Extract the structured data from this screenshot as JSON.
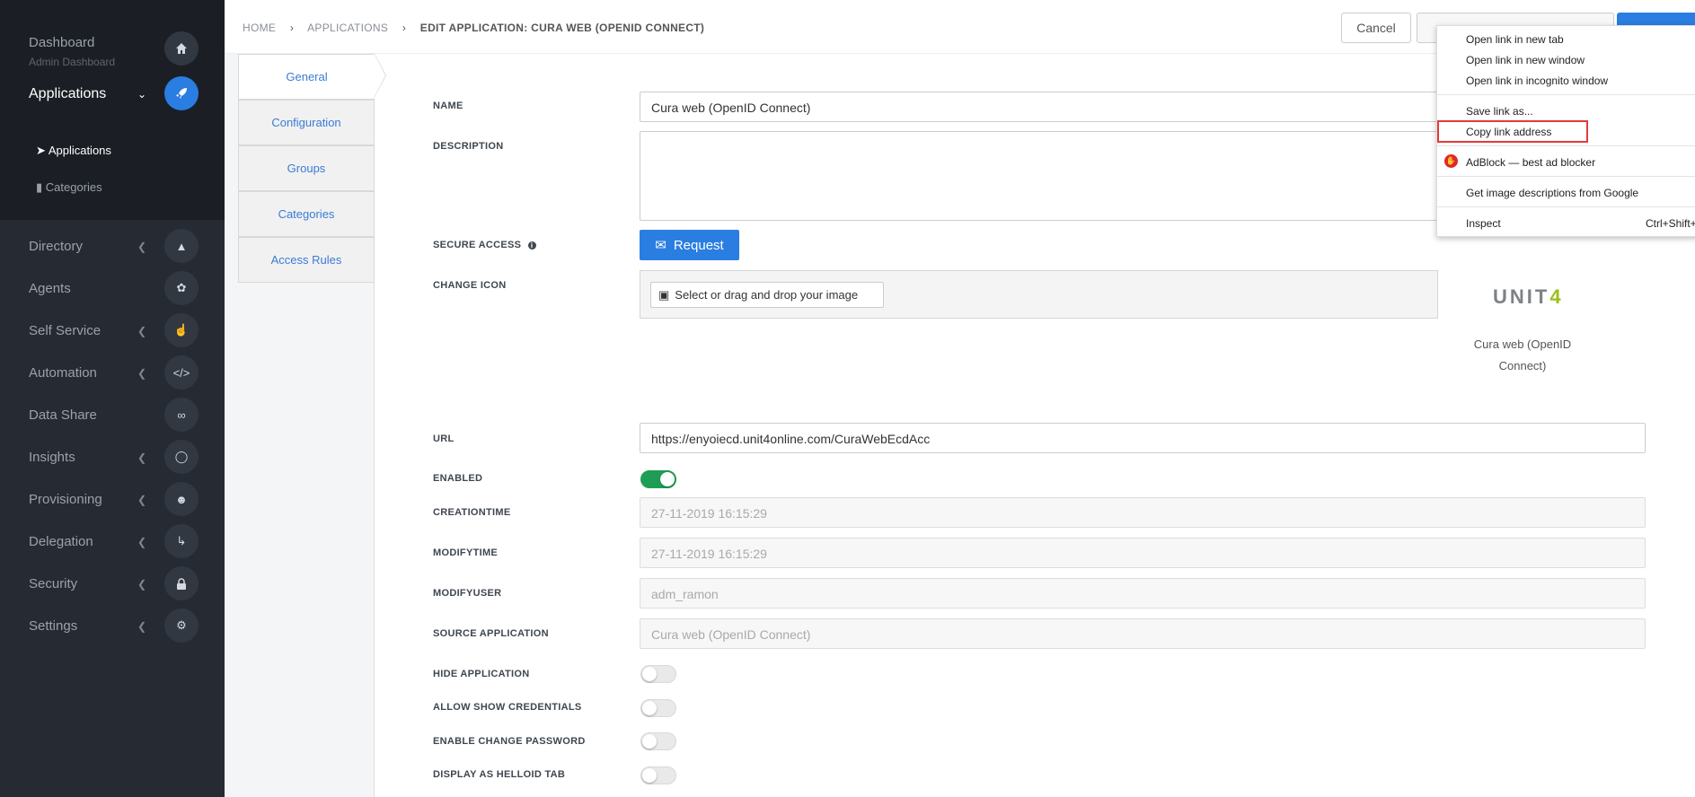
{
  "sidebar": {
    "dashboard": {
      "label": "Dashboard",
      "sub": "Admin Dashboard"
    },
    "applications": {
      "label": "Applications"
    },
    "subitems": [
      {
        "label": "Applications"
      },
      {
        "label": "Categories"
      }
    ],
    "items": [
      {
        "label": "Directory"
      },
      {
        "label": "Agents"
      },
      {
        "label": "Self Service"
      },
      {
        "label": "Automation"
      },
      {
        "label": "Data Share"
      },
      {
        "label": "Insights"
      },
      {
        "label": "Provisioning"
      },
      {
        "label": "Delegation"
      },
      {
        "label": "Security"
      },
      {
        "label": "Settings"
      }
    ]
  },
  "breadcrumb": {
    "home": "HOME",
    "applications": "APPLICATIONS",
    "current": "EDIT APPLICATION: CURA WEB (OPENID CONNECT)"
  },
  "toolbar": {
    "cancel": "Cancel"
  },
  "tabs": [
    {
      "label": "General"
    },
    {
      "label": "Configuration"
    },
    {
      "label": "Groups"
    },
    {
      "label": "Categories"
    },
    {
      "label": "Access Rules"
    }
  ],
  "form": {
    "name_label": "NAME",
    "name_value": "Cura web (OpenID Connect)",
    "description_label": "DESCRIPTION",
    "secure_access_label": "SECURE ACCESS",
    "request_button": "Request",
    "change_icon_label": "CHANGE ICON",
    "select_image": "Select or drag and drop your image",
    "url_label": "URL",
    "url_value": "https://enyoiecd.unit4online.com/CuraWebEcdAcc",
    "enabled_label": "ENABLED",
    "creationtime_label": "CREATIONTIME",
    "creationtime_value": "27-11-2019 16:15:29",
    "modifytime_label": "MODIFYTIME",
    "modifytime_value": "27-11-2019 16:15:29",
    "modifyuser_label": "MODIFYUSER",
    "modifyuser_value": "adm_ramon",
    "source_label": "SOURCE APPLICATION",
    "source_value": "Cura web (OpenID Connect)",
    "hide_label": "HIDE APPLICATION",
    "allow_show_label": "ALLOW SHOW CREDENTIALS",
    "enable_change_label": "ENABLE CHANGE PASSWORD",
    "display_tab_label": "DISPLAY AS HELLOID TAB"
  },
  "app_preview": {
    "logo_text_a": "UNIT",
    "logo_text_b": "4",
    "caption": "Cura web (OpenID Connect)"
  },
  "context_menu": {
    "items": [
      "Open link in new tab",
      "Open link in new window",
      "Open link in incognito window",
      "Save link as...",
      "Copy link address",
      "AdBlock — best ad blocker",
      "Get image descriptions from Google",
      "Inspect"
    ],
    "inspect_shortcut": "Ctrl+Shift+"
  },
  "colors": {
    "accent": "#2a7de1",
    "toggle_on": "#1f9d55",
    "highlight": "#e23b3b"
  }
}
